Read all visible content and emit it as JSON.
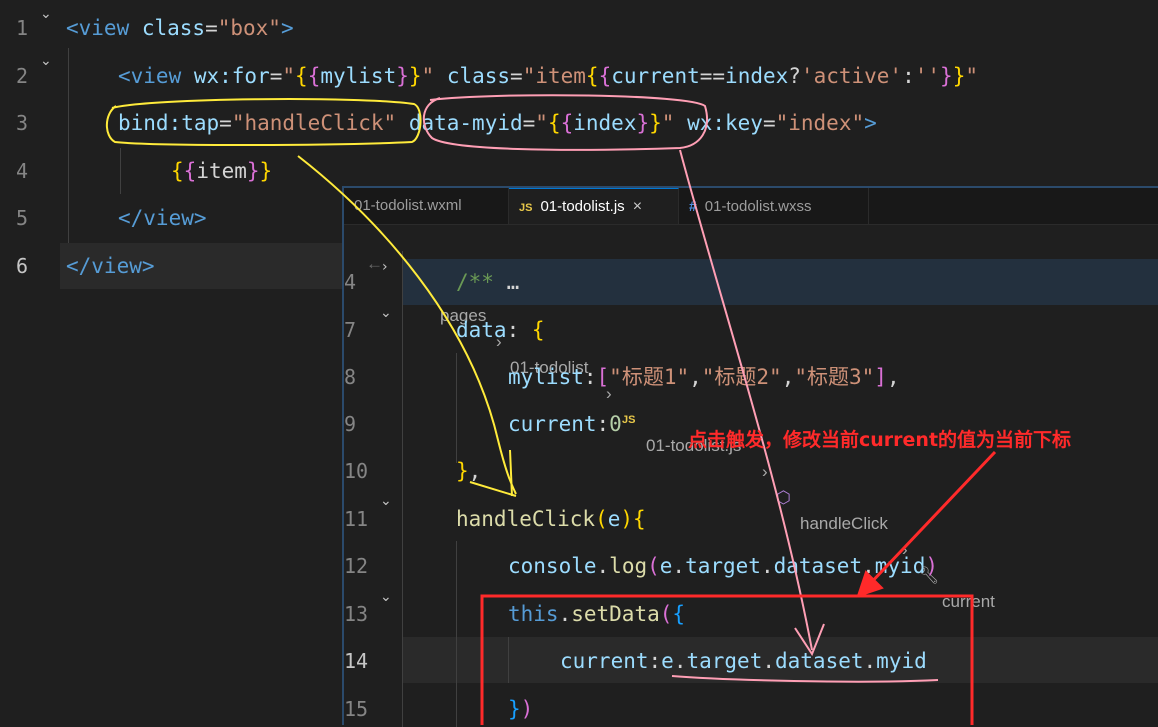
{
  "back_editor": {
    "lines": [
      {
        "n": "1",
        "parts": [
          [
            "tag",
            "<view"
          ],
          [
            "attr",
            " class"
          ],
          [
            "txt",
            "="
          ],
          [
            "str",
            "\"box\""
          ],
          [
            "tag",
            ">"
          ]
        ]
      },
      {
        "n": "2",
        "parts": [
          [
            "tag",
            "<view"
          ],
          [
            "attr",
            " wx:for"
          ],
          [
            "txt",
            "="
          ],
          [
            "str",
            "\""
          ],
          [
            "br1",
            "{"
          ],
          [
            "br2",
            "{"
          ],
          [
            "attr",
            "mylist"
          ],
          [
            "br2",
            "}"
          ],
          [
            "br1",
            "}"
          ],
          [
            "str",
            "\""
          ],
          [
            "attr",
            " class"
          ],
          [
            "txt",
            "="
          ],
          [
            "str",
            "\"item"
          ],
          [
            "br1",
            "{"
          ],
          [
            "br2",
            "{"
          ],
          [
            "attr",
            "current"
          ],
          [
            "txt",
            "=="
          ],
          [
            "attr",
            "index"
          ],
          [
            "txt",
            "?"
          ],
          [
            "str",
            "'active'"
          ],
          [
            "txt",
            ":"
          ],
          [
            "str",
            "''"
          ],
          [
            "br2",
            "}"
          ],
          [
            "br1",
            "}"
          ],
          [
            "str",
            "\""
          ]
        ]
      },
      {
        "n": "3",
        "parts": [
          [
            "attr",
            "bind:tap"
          ],
          [
            "txt",
            "="
          ],
          [
            "str",
            "\"handleClick\""
          ],
          [
            "attr",
            " data-myid"
          ],
          [
            "txt",
            "="
          ],
          [
            "str",
            "\""
          ],
          [
            "br1",
            "{"
          ],
          [
            "br2",
            "{"
          ],
          [
            "attr",
            "index"
          ],
          [
            "br2",
            "}"
          ],
          [
            "br1",
            "}"
          ],
          [
            "str",
            "\""
          ],
          [
            "attr",
            " wx:key"
          ],
          [
            "txt",
            "="
          ],
          [
            "str",
            "\"index\""
          ],
          [
            "tag",
            ">"
          ]
        ]
      },
      {
        "n": "4",
        "parts": [
          [
            "br1",
            "{"
          ],
          [
            "br2",
            "{"
          ],
          [
            "txt",
            "item"
          ],
          [
            "br2",
            "}"
          ],
          [
            "br1",
            "}"
          ]
        ]
      },
      {
        "n": "5",
        "parts": [
          [
            "tag",
            "</view>"
          ]
        ]
      },
      {
        "n": "6",
        "parts": [
          [
            "tag",
            "</view>"
          ]
        ]
      }
    ]
  },
  "tabs": [
    {
      "label": "01-todolist.wxml",
      "icon": "",
      "active": false
    },
    {
      "label": "01-todolist.js",
      "icon": "JS",
      "active": true,
      "close": "×"
    },
    {
      "label": "01-todolist.wxss",
      "icon": "#",
      "active": false
    }
  ],
  "breadcrumb": {
    "back": "←",
    "forward": "→",
    "items": [
      "pages",
      "01-todolist",
      "01-todolist.js",
      "handleClick",
      "current"
    ],
    "sep": "›"
  },
  "front_editor": {
    "lines": [
      {
        "n": "4",
        "parts": [
          [
            "comment",
            "/**"
          ],
          [
            "txt",
            " …"
          ]
        ]
      },
      {
        "n": "7",
        "parts": [
          [
            "var",
            "data"
          ],
          [
            "punc",
            ": "
          ],
          [
            "br1",
            "{"
          ]
        ]
      },
      {
        "n": "8",
        "parts": [
          [
            "var",
            "mylist"
          ],
          [
            "punc",
            ":"
          ],
          [
            "br2",
            "["
          ],
          [
            "str",
            "\"标题1\""
          ],
          [
            "punc",
            ","
          ],
          [
            "str",
            "\"标题2\""
          ],
          [
            "punc",
            ","
          ],
          [
            "str",
            "\"标题3\""
          ],
          [
            "br2",
            "]"
          ],
          [
            "punc",
            ","
          ]
        ]
      },
      {
        "n": "9",
        "parts": [
          [
            "var",
            "current"
          ],
          [
            "punc",
            ":"
          ],
          [
            "num",
            "0"
          ]
        ]
      },
      {
        "n": "10",
        "parts": [
          [
            "br1",
            "}"
          ],
          [
            "punc",
            ","
          ]
        ]
      },
      {
        "n": "11",
        "parts": [
          [
            "fn",
            "handleClick"
          ],
          [
            "br1",
            "("
          ],
          [
            "var",
            "e"
          ],
          [
            "br1",
            ")"
          ],
          [
            "br1",
            "{"
          ]
        ]
      },
      {
        "n": "12",
        "parts": [
          [
            "var",
            "console"
          ],
          [
            "punc",
            "."
          ],
          [
            "fn",
            "log"
          ],
          [
            "br2",
            "("
          ],
          [
            "var",
            "e"
          ],
          [
            "punc",
            "."
          ],
          [
            "var",
            "target"
          ],
          [
            "punc",
            "."
          ],
          [
            "var",
            "dataset"
          ],
          [
            "punc",
            "."
          ],
          [
            "var",
            "myid"
          ],
          [
            "br2",
            ")"
          ]
        ]
      },
      {
        "n": "13",
        "parts": [
          [
            "kw",
            "this"
          ],
          [
            "punc",
            "."
          ],
          [
            "fn",
            "setData"
          ],
          [
            "br2",
            "("
          ],
          [
            "br3",
            "{"
          ]
        ]
      },
      {
        "n": "14",
        "parts": [
          [
            "var",
            "current"
          ],
          [
            "punc",
            ":"
          ],
          [
            "var",
            "e"
          ],
          [
            "punc",
            "."
          ],
          [
            "var",
            "target"
          ],
          [
            "punc",
            "."
          ],
          [
            "var",
            "dataset"
          ],
          [
            "punc",
            "."
          ],
          [
            "var",
            "myid"
          ]
        ]
      },
      {
        "n": "15",
        "parts": [
          [
            "br3",
            "}"
          ],
          [
            "br2",
            ")"
          ]
        ]
      }
    ]
  },
  "annotation_text": "点击触发，修改当前current的值为当前下标",
  "colors": {
    "red": "#ff2a2a",
    "yellow": "#ffeb3b",
    "pink": "#ff9fb5"
  }
}
